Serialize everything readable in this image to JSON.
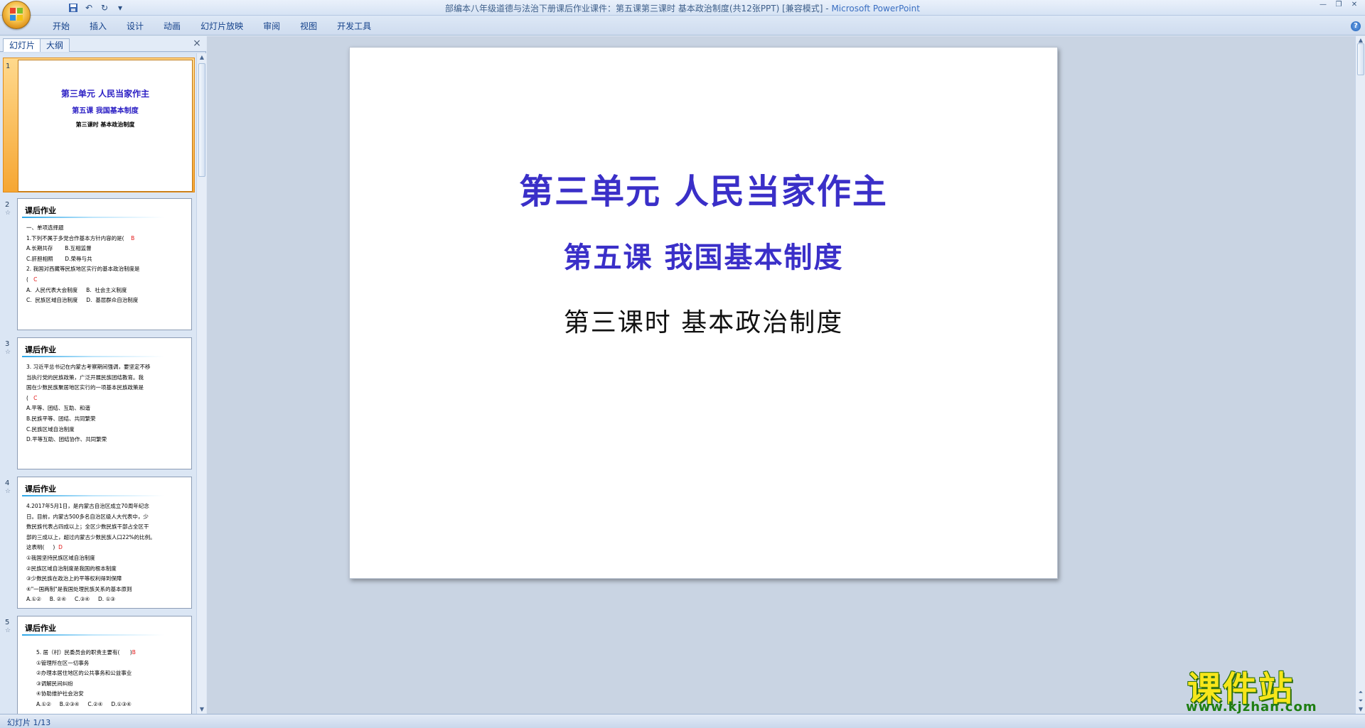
{
  "window": {
    "title": "部编本八年级道德与法治下册课后作业课件：第五课第三课时 基本政治制度(共12张PPT) [兼容模式]",
    "app_name": "Microsoft PowerPoint",
    "separator": " - "
  },
  "quick_access": {
    "undo": "↶",
    "redo": "↻",
    "more": "▾"
  },
  "ribbon": {
    "tabs": [
      "开始",
      "插入",
      "设计",
      "动画",
      "幻灯片放映",
      "审阅",
      "视图",
      "开发工具"
    ],
    "help": "?"
  },
  "left_pane": {
    "tabs": [
      "幻灯片",
      "大纲"
    ],
    "close": "×"
  },
  "slides": [
    {
      "num": "1",
      "title": "第三单元  人民当家作主",
      "subtitle": "第五课  我国基本制度",
      "subtitle2": "第三课时   基本政治制度"
    },
    {
      "num": "2",
      "header": "课后作业",
      "body": "一、单项选择题\n1.下列不属于多党合作基本方针内容的是(",
      "answer": "B",
      "body2": "A.长期共存       B.互相监督\nC.肝胆相照       D.荣辱与共\n2. 我国对西藏等民族地区实行的基本政治制度是\n(",
      "answer2": "C",
      "body3": "A.  人民代表大会制度     B.  社会主义制度\nC.  民族区域自治制度     D.  基层群众自治制度"
    },
    {
      "num": "3",
      "header": "课后作业",
      "body": "3. 习近平总书记在内蒙古考察期间强调，要坚定不移\n当执行党的民族政策，广泛开展民族团结教育。我\n国在少数民族聚居地区实行的一项基本民族政策是\n(",
      "answer": "C",
      "body2": "A.平等、团结、互助、和谐\nB.民族平等、团结、共同繁荣\nC.民族区域自治制度\nD.平等互助、团结协作、共同繁荣"
    },
    {
      "num": "4",
      "header": "课后作业",
      "body": "4.2017年5月1日，是内蒙古自治区成立70周年纪念\n日。目前，内蒙古500多名自治区级人大代表中，少\n数民族代表占四成以上；全区少数民族干部占全区干\n部的三成以上，超过内蒙古少数民族人口22%的比例。\n这表明(     )",
      "answer": "D",
      "body2": "①我国坚持民族区域自治制度\n②民族区域自治制度是我国的根本制度\n③少数民族在政治上的平等权利得到保障\n④\"一国两制\"是我国处理民族关系的基本原则\nA.①②     B. ②④     C.③④     D. ①③"
    },
    {
      "num": "5",
      "header": "课后作业",
      "body": "5. 居（村）民委员会的职责主要有(      )",
      "answer": "B",
      "body2": "①管理所在区一切事务\n②办理本居住地区的公共事务和公益事业\n③调解民间纠纷\n④协助维护社会治安\nA.①②     B.②③④     C.②④     D.①③④"
    }
  ],
  "main_slide": {
    "title": "第三单元   人民当家作主",
    "subtitle": "第五课  我国基本制度",
    "subtitle2": "第三课时    基本政治制度"
  },
  "watermark": {
    "logo": "课件站",
    "url": "www.kjzhan.com"
  },
  "status": {
    "text": "幻灯片 1/13"
  },
  "colors": {
    "title_blue": "#3a2fc8",
    "answer_red": "#e21616",
    "selected_orange": "#f6a632"
  }
}
